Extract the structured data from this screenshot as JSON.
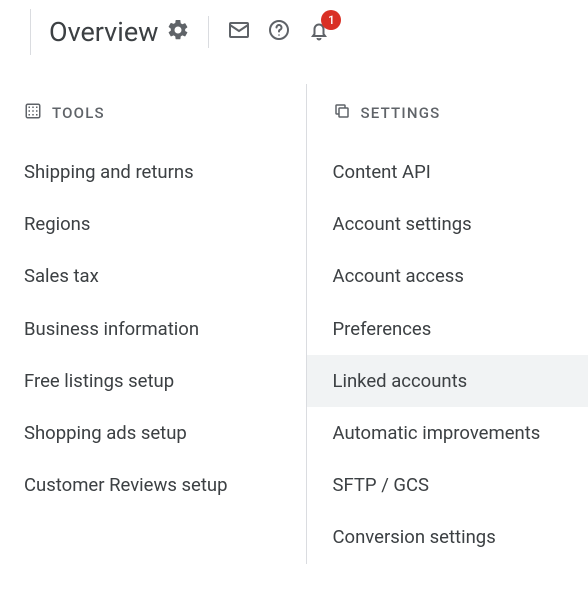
{
  "header": {
    "title": "Overview",
    "notification_count": "1"
  },
  "tools": {
    "heading": "TOOLS",
    "items": [
      "Shipping and returns",
      "Regions",
      "Sales tax",
      "Business information",
      "Free listings setup",
      "Shopping ads setup",
      "Customer Reviews setup"
    ]
  },
  "settings": {
    "heading": "SETTINGS",
    "items": [
      "Content API",
      "Account settings",
      "Account access",
      "Preferences",
      "Linked accounts",
      "Automatic improvements",
      "SFTP / GCS",
      "Conversion settings"
    ],
    "highlighted_index": 4
  }
}
